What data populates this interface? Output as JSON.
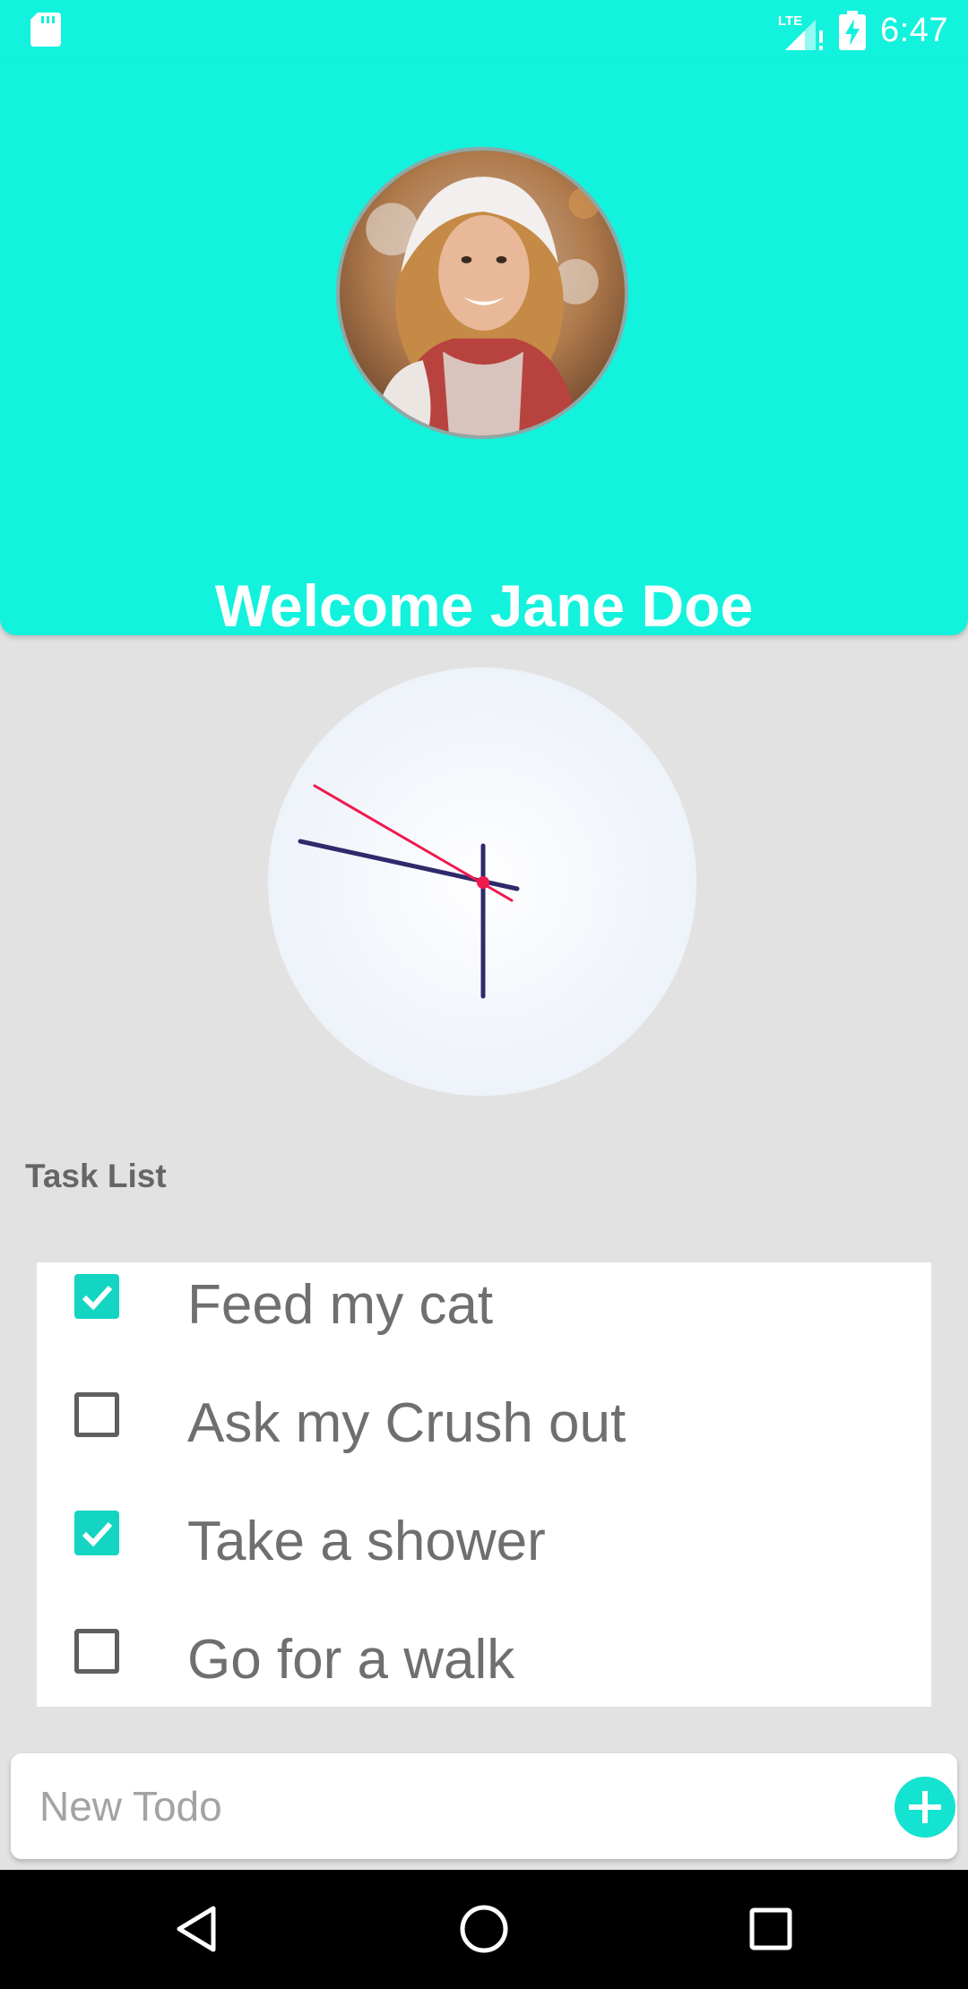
{
  "status_bar": {
    "time": "6:47",
    "network_label": "LTE",
    "icons": [
      "sd-card-icon",
      "lte-signal-icon",
      "battery-charging-icon"
    ]
  },
  "header": {
    "welcome": "Welcome Jane Doe",
    "background_color": "#13f2dd"
  },
  "clock": {
    "hour_hand_color": "#2f2a6b",
    "second_hand_color": "#f0194e"
  },
  "tasks": {
    "section_label": "Task List",
    "items": [
      {
        "label": "Feed my cat",
        "done": true
      },
      {
        "label": "Ask my Crush out",
        "done": false
      },
      {
        "label": "Take a shower",
        "done": true
      },
      {
        "label": "Go for a walk",
        "done": false
      }
    ],
    "accent_color": "#13d5c1"
  },
  "new_todo": {
    "placeholder": "New Todo",
    "value": "",
    "add_icon": "plus-icon"
  },
  "nav_bar": {
    "icons": [
      "back-icon",
      "home-icon",
      "recents-icon"
    ]
  }
}
